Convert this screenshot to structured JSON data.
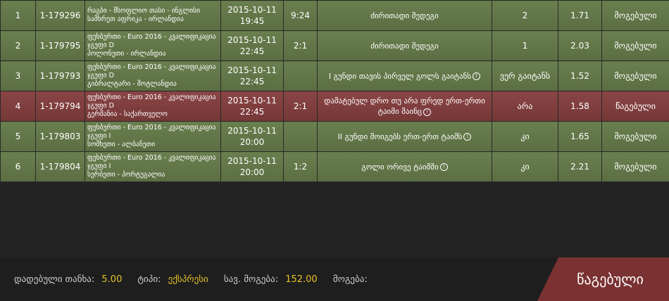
{
  "rows": [
    {
      "status": "won",
      "num": "1",
      "id": "1-179296",
      "event": [
        "რაგბი - მსოფლიო თასი - ინგლისი",
        "სამხრეთ აფრიკა - ირლანდია"
      ],
      "date": "2015-10-11",
      "time": "19:45",
      "score": "9:24",
      "market": "ძირითადი შედეგი",
      "info": false,
      "selection": "2",
      "odds": "1.71",
      "result": "მოგებული"
    },
    {
      "status": "won",
      "num": "2",
      "id": "1-179795",
      "event": [
        "ფეხბურთი - Euro 2016 - კვალიფიკაცია",
        "ჯგუფი D",
        "პოლონეთი - ირლანდია"
      ],
      "date": "2015-10-11",
      "time": "22:45",
      "score": "2:1",
      "market": "ძირითადი შედეგი",
      "info": false,
      "selection": "1",
      "odds": "2.03",
      "result": "მოგებული"
    },
    {
      "status": "won",
      "num": "3",
      "id": "1-179793",
      "event": [
        "ფეხბურთი - Euro 2016 - კვალიფიკაცია",
        "ჯგუფი D",
        "გიბრალტარი - შოტლანდია"
      ],
      "date": "2015-10-11",
      "time": "22:45",
      "score": "",
      "market": "I გუნდი თავის პირველ გოლს გაიტანს",
      "info": true,
      "selection": "ვერ გაიტანს",
      "odds": "1.52",
      "result": "მოგებული"
    },
    {
      "status": "lost",
      "num": "4",
      "id": "1-179794",
      "event": [
        "ფეხბურთი - Euro 2016 - კვალიფიკაცია",
        "ჯგუფი D",
        "გერმანია - საქართველო"
      ],
      "date": "2015-10-11",
      "time": "22:45",
      "score": "2:1",
      "market": "დამატებულ დრო თუ არა ფრედ ერთ-ერთი ტაიმი მაინც",
      "info": true,
      "selection": "არა",
      "odds": "1.58",
      "result": "წაგებული"
    },
    {
      "status": "won",
      "num": "5",
      "id": "1-179803",
      "event": [
        "ფეხბურთი - Euro 2016 - კვალიფიკაცია",
        "ჯგუფი I",
        "სომხეთი - ალბანეთი"
      ],
      "date": "2015-10-11",
      "time": "20:00",
      "score": "",
      "market": "II გუნდი მოიგებს ერთ-ერთ ტაიმს",
      "info": true,
      "selection": "კი",
      "odds": "1.65",
      "result": "მოგებული"
    },
    {
      "status": "won",
      "num": "6",
      "id": "1-179804",
      "event": [
        "ფეხბურთი - Euro 2016 - კვალიფიკაცია",
        "ჯგუფი I",
        "სერბეთი - პორტუგალია"
      ],
      "date": "2015-10-11",
      "time": "20:00",
      "score": "1:2",
      "market": "გოლი ორივე ტაიმში",
      "info": true,
      "selection": "კი",
      "odds": "2.21",
      "result": "მოგებული"
    }
  ],
  "footer": {
    "stake_label": "დადებული თანხა:",
    "stake_value": "5.00",
    "type_label": "ტიპი:",
    "type_value": "ექსპრესი",
    "potential_label": "სავ. მოგება:",
    "potential_value": "152.00",
    "win_label": "მოგება:",
    "win_value": "",
    "status": "წაგებული"
  },
  "info_icon": "info-icon"
}
